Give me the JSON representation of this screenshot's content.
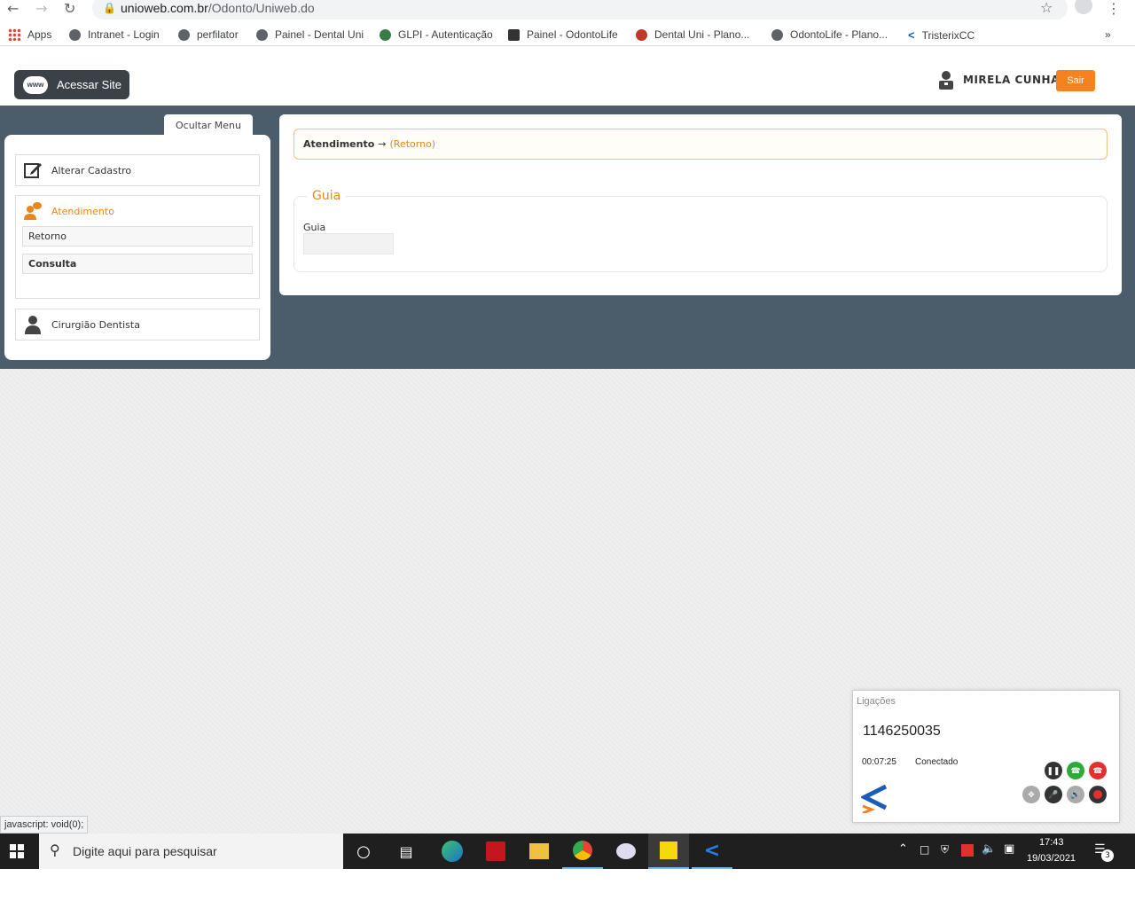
{
  "browser": {
    "url_domain": "unioweb.com.br",
    "url_path": "/Odonto/Uniweb.do",
    "bookmarks": [
      "Apps",
      "Intranet - Login",
      "perfilator",
      "Painel - Dental Uni",
      "GLPI - Autenticação",
      "Painel - OdontoLife",
      "Dental Uni - Plano...",
      "OdontoLife - Plano...",
      "TristerixCC"
    ],
    "more_bookmarks": "»"
  },
  "header": {
    "acessar_label": "Acessar Site",
    "www_label": "www",
    "user_name": "MIRELA CUNHA",
    "logout_label": "Sair"
  },
  "sidebar": {
    "toggle_label": "Ocultar Menu",
    "items": [
      {
        "label": "Alterar Cadastro",
        "icon": "edit-icon"
      },
      {
        "label": "Atendimento",
        "icon": "user-chat-icon",
        "subitems": [
          "Retorno",
          "Consulta"
        ]
      },
      {
        "label": "Cirurgião Dentista",
        "icon": "dentist-icon"
      }
    ]
  },
  "main": {
    "breadcrumb_section": "Atendimento",
    "breadcrumb_arrow": "→",
    "breadcrumb_current": "(Retorno)",
    "fieldset_legend": "Guia",
    "guia_label": "Guia",
    "guia_value": ""
  },
  "status_bar": "javascript: void(0);",
  "call_widget": {
    "title": "Ligações",
    "number": "1146250035",
    "duration": "00:07:25",
    "status": "Conectado"
  },
  "taskbar": {
    "search_placeholder": "Digite aqui para pesquisar",
    "time": "17:43",
    "date": "19/03/2021",
    "notification_count": "3"
  },
  "colors": {
    "accent": "#e8871e",
    "dark_band": "#4b5d6b",
    "logout": "#f5811f"
  }
}
